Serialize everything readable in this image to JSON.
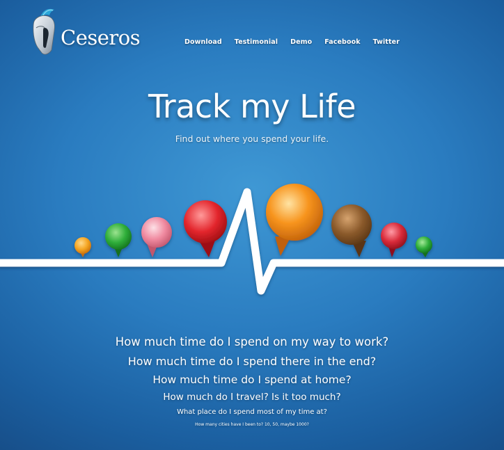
{
  "brand": {
    "name": "Ceseros",
    "logo_icon": "spartan-helmet-icon"
  },
  "nav": {
    "items": [
      {
        "label": "Download"
      },
      {
        "label": "Testimonial"
      },
      {
        "label": "Demo"
      },
      {
        "label": "Facebook"
      },
      {
        "label": "Twitter"
      }
    ]
  },
  "hero": {
    "title": "Track my Life",
    "subtitle": "Find out where you spend your life."
  },
  "illustration": {
    "icon": "heartbeat-line-with-location-pins-icon",
    "pin_colors": [
      "#f5a623",
      "#2fae3a",
      "#f08aa0",
      "#e3262d",
      "#f7941d",
      "#8b5a2b",
      "#d92b3a",
      "#2fae3a"
    ]
  },
  "questions": [
    "How much time do I spend on my way to work?",
    "How much time do I spend there in the end?",
    "How much time do I spend at home?",
    "How much do I travel? Is it too much?",
    "What place do I spend most of my time at?",
    "How many cities have I been to? 10, 50, maybe 1000?"
  ]
}
